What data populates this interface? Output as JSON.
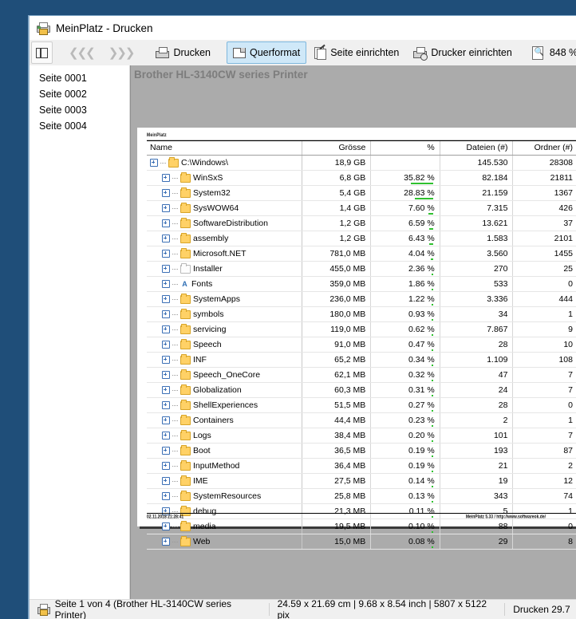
{
  "window": {
    "title": "MeinPlatz - Drucken",
    "title_icon": "printer-icon"
  },
  "toolbar": {
    "sidebar_toggle_icon": "sidebar-toggle-icon",
    "prev_icon": "previous-page-icon",
    "next_icon": "next-page-icon",
    "print_label": "Drucken",
    "landscape_label": "Querformat",
    "page_setup_label": "Seite einrichten",
    "printer_setup_label": "Drucker einrichten",
    "zoom_value": "848 %",
    "zoom_dropdown_icon": "chevron-down-icon",
    "zoom_slider_icon": "zoom-slider",
    "overflow_icon": "toolbar-overflow-icon"
  },
  "pagelist": {
    "items": [
      {
        "label": "Seite 0001"
      },
      {
        "label": "Seite 0002"
      },
      {
        "label": "Seite 0003"
      },
      {
        "label": "Seite 0004"
      }
    ]
  },
  "preview": {
    "printer_label": "Brother HL-3140CW series Printer"
  },
  "report": {
    "brand": "MeinPlatz",
    "columns": [
      "Name",
      "Grösse",
      "%",
      "Dateien (#)",
      "Ordner (#)"
    ],
    "rows": [
      {
        "name": "C:\\Windows\\",
        "indent": 0,
        "icon": "folder",
        "size": "18,9 GB",
        "pct": "",
        "bar": 0,
        "files": "145.530",
        "folders": "28308"
      },
      {
        "name": "WinSxS",
        "indent": 1,
        "icon": "folder",
        "size": "6,8 GB",
        "pct": "35.82 %",
        "bar": 35.82,
        "files": "82.184",
        "folders": "21811"
      },
      {
        "name": "System32",
        "indent": 1,
        "icon": "folder",
        "size": "5,4 GB",
        "pct": "28.83 %",
        "bar": 28.83,
        "files": "21.159",
        "folders": "1367"
      },
      {
        "name": "SysWOW64",
        "indent": 1,
        "icon": "folder",
        "size": "1,4 GB",
        "pct": "7.60 %",
        "bar": 7.6,
        "files": "7.315",
        "folders": "426"
      },
      {
        "name": "SoftwareDistribution",
        "indent": 1,
        "icon": "folder",
        "size": "1,2 GB",
        "pct": "6.59 %",
        "bar": 6.59,
        "files": "13.621",
        "folders": "37"
      },
      {
        "name": "assembly",
        "indent": 1,
        "icon": "folder",
        "size": "1,2 GB",
        "pct": "6.43 %",
        "bar": 6.43,
        "files": "1.583",
        "folders": "2101"
      },
      {
        "name": "Microsoft.NET",
        "indent": 1,
        "icon": "folder",
        "size": "781,0 MB",
        "pct": "4.04 %",
        "bar": 4.04,
        "files": "3.560",
        "folders": "1455"
      },
      {
        "name": "Installer",
        "indent": 1,
        "icon": "folder-white",
        "size": "455,0 MB",
        "pct": "2.36 %",
        "bar": 2.36,
        "files": "270",
        "folders": "25"
      },
      {
        "name": "Fonts",
        "indent": 1,
        "icon": "fonts",
        "size": "359,0 MB",
        "pct": "1.86 %",
        "bar": 1.86,
        "files": "533",
        "folders": "0"
      },
      {
        "name": "SystemApps",
        "indent": 1,
        "icon": "folder",
        "size": "236,0 MB",
        "pct": "1.22 %",
        "bar": 1.22,
        "files": "3.336",
        "folders": "444"
      },
      {
        "name": "symbols",
        "indent": 1,
        "icon": "folder",
        "size": "180,0 MB",
        "pct": "0.93 %",
        "bar": 0.93,
        "files": "34",
        "folders": "1"
      },
      {
        "name": "servicing",
        "indent": 1,
        "icon": "folder",
        "size": "119,0 MB",
        "pct": "0.62 %",
        "bar": 0.62,
        "files": "7.867",
        "folders": "9"
      },
      {
        "name": "Speech",
        "indent": 1,
        "icon": "folder",
        "size": "91,0 MB",
        "pct": "0.47 %",
        "bar": 0.47,
        "files": "28",
        "folders": "10"
      },
      {
        "name": "INF",
        "indent": 1,
        "icon": "folder",
        "size": "65,2 MB",
        "pct": "0.34 %",
        "bar": 0.34,
        "files": "1.109",
        "folders": "108"
      },
      {
        "name": "Speech_OneCore",
        "indent": 1,
        "icon": "folder",
        "size": "62,1 MB",
        "pct": "0.32 %",
        "bar": 0.32,
        "files": "47",
        "folders": "7"
      },
      {
        "name": "Globalization",
        "indent": 1,
        "icon": "folder",
        "size": "60,3 MB",
        "pct": "0.31 %",
        "bar": 0.31,
        "files": "24",
        "folders": "7"
      },
      {
        "name": "ShellExperiences",
        "indent": 1,
        "icon": "folder",
        "size": "51,5 MB",
        "pct": "0.27 %",
        "bar": 0.27,
        "files": "28",
        "folders": "0"
      },
      {
        "name": "Containers",
        "indent": 1,
        "icon": "folder",
        "size": "44,4 MB",
        "pct": "0.23 %",
        "bar": 0.23,
        "files": "2",
        "folders": "1"
      },
      {
        "name": "Logs",
        "indent": 1,
        "icon": "folder",
        "size": "38,4 MB",
        "pct": "0.20 %",
        "bar": 0.2,
        "files": "101",
        "folders": "7"
      },
      {
        "name": "Boot",
        "indent": 1,
        "icon": "folder",
        "size": "36,5 MB",
        "pct": "0.19 %",
        "bar": 0.19,
        "files": "193",
        "folders": "87"
      },
      {
        "name": "InputMethod",
        "indent": 1,
        "icon": "folder",
        "size": "36,4 MB",
        "pct": "0.19 %",
        "bar": 0.19,
        "files": "21",
        "folders": "2"
      },
      {
        "name": "IME",
        "indent": 1,
        "icon": "folder",
        "size": "27,5 MB",
        "pct": "0.14 %",
        "bar": 0.14,
        "files": "19",
        "folders": "12"
      },
      {
        "name": "SystemResources",
        "indent": 1,
        "icon": "folder",
        "size": "25,8 MB",
        "pct": "0.13 %",
        "bar": 0.13,
        "files": "343",
        "folders": "74"
      },
      {
        "name": "debug",
        "indent": 1,
        "icon": "folder",
        "size": "21,3 MB",
        "pct": "0.11 %",
        "bar": 0.11,
        "files": "5",
        "folders": "1"
      },
      {
        "name": "media",
        "indent": 1,
        "icon": "folder",
        "size": "19,5 MB",
        "pct": "0.10 %",
        "bar": 0.1,
        "files": "88",
        "folders": "0"
      },
      {
        "name": "Web",
        "indent": 1,
        "icon": "folder",
        "size": "15,0 MB",
        "pct": "0.08 %",
        "bar": 0.08,
        "files": "29",
        "folders": "8"
      }
    ],
    "footer_left": "02.11.2018 21:28:41",
    "footer_right": "MeinPlatz  5.33 / http://www.softwareok.de/"
  },
  "statusbar": {
    "page_info": "Seite 1 von 4 (Brother HL-3140CW series Printer)",
    "dimensions": "24.59 x 21.69 cm | 9.68 x 8.54 inch | 5807 x 5122 pix",
    "print_info": "Drucken 29.7",
    "icon": "printer-icon"
  },
  "colors": {
    "accent": "#0a7ad1",
    "bar_green": "#2fc12f",
    "folder": "#ffd166",
    "preview_bg": "#ababab"
  }
}
